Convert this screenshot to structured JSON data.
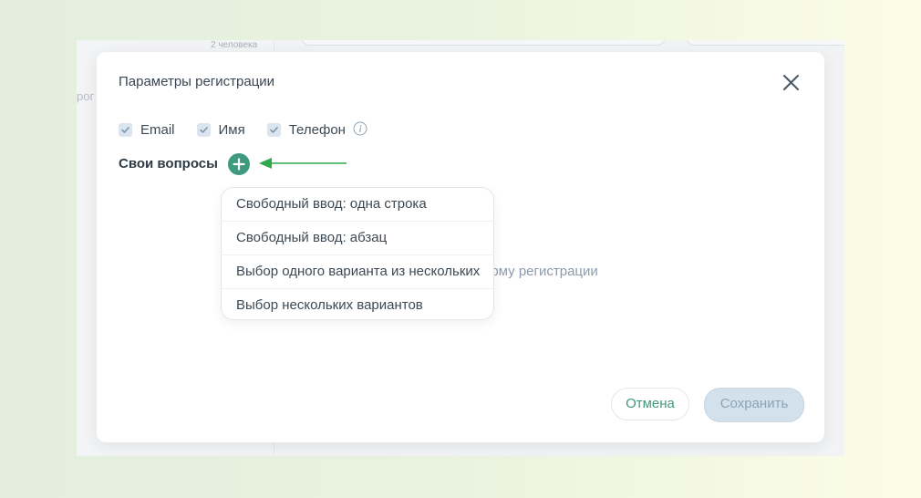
{
  "background_app": {
    "participants_count": "2 человека",
    "left_text": "рог"
  },
  "modal": {
    "title": "Параметры регистрации",
    "close_icon": "close-icon",
    "fields": [
      {
        "label": "Email",
        "checked": true
      },
      {
        "label": "Имя",
        "checked": true
      },
      {
        "label": "Телефон",
        "checked": true
      }
    ],
    "info_icon": "info-icon",
    "own_questions_label": "Свои вопросы",
    "add_icon": "plus-icon",
    "arrow_color": "#2eaa4a",
    "hint_text": "орму регистрации",
    "dropdown_items": [
      "Свободный ввод: одна строка",
      "Свободный ввод: абзац",
      "Выбор одного варианта из нескольких",
      "Выбор нескольких вариантов"
    ],
    "cancel_label": "Отмена",
    "save_label": "Сохранить"
  },
  "colors": {
    "accent": "#3d9a7d",
    "save_disabled_bg": "#d3e1ec",
    "text": "#3d4954"
  }
}
